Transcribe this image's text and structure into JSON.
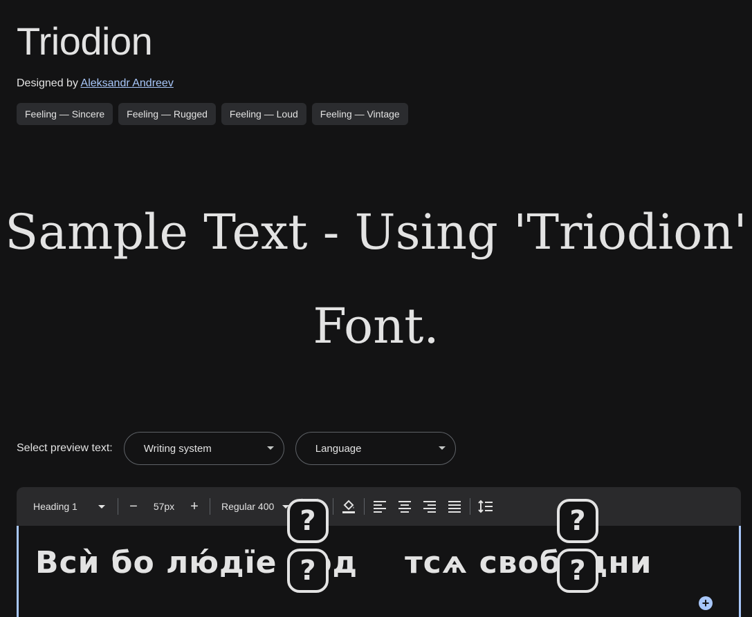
{
  "header": {
    "font_name": "Triodion",
    "designed_by_prefix": "Designed by ",
    "designer_name": "Aleksandr Andreev"
  },
  "tags": [
    "Feeling — Sincere",
    "Feeling — Rugged",
    "Feeling — Loud",
    "Feeling — Vintage"
  ],
  "sample": {
    "text": "Sample Text - Using 'Triodion' Font."
  },
  "preview": {
    "label": "Select preview text:",
    "writing_system": "Writing system",
    "language": "Language"
  },
  "toolbar": {
    "style": "Heading 1",
    "decrease": "−",
    "size": "57px",
    "increase": "+",
    "weight": "Regular 400"
  },
  "editor": {
    "text_part1": "Всѝ бо лю́дїе род",
    "text_part2": "тсѧ свобо́дни",
    "missing_glyph": "?",
    "add_symbol": "+"
  },
  "colors": {
    "background": "#131314",
    "accent": "#a8c7fa",
    "text": "#e3e3e3"
  }
}
